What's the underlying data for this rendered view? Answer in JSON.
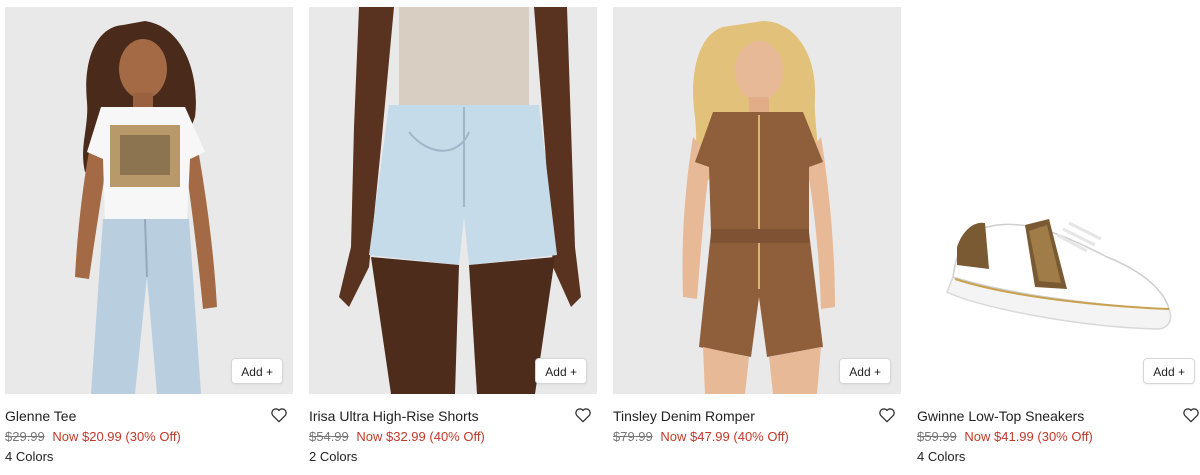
{
  "products": [
    {
      "name": "Glenne Tee",
      "original_price": "$29.99",
      "sale_price": "Now $20.99 (30% Off)",
      "colors": "4 Colors",
      "add_label": "Add +",
      "image": "woman-in-graphic-tee-and-jeans"
    },
    {
      "name": "Irisa Ultra High-Rise Shorts",
      "original_price": "$54.99",
      "sale_price": "Now $32.99 (40% Off)",
      "colors": "2 Colors",
      "add_label": "Add +",
      "image": "light-denim-shorts"
    },
    {
      "name": "Tinsley Denim Romper",
      "original_price": "$79.99",
      "sale_price": "Now $47.99 (40% Off)",
      "colors": "",
      "add_label": "Add +",
      "image": "woman-in-brown-zip-romper"
    },
    {
      "name": "Gwinne Low-Top Sneakers",
      "original_price": "$59.99",
      "sale_price": "Now $41.99 (30% Off)",
      "colors": "4 Colors",
      "add_label": "Add +",
      "image": "white-sneaker-with-logo-stripe"
    }
  ],
  "colors_theme": {
    "sale_red": "#c0392b",
    "strike_gray": "#777777",
    "image_bg": "#e9e9ea"
  }
}
